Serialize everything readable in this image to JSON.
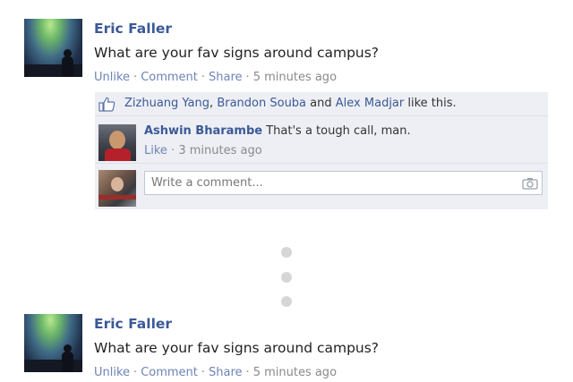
{
  "stories": [
    {
      "author": "Eric Faller",
      "message": "What are your fav signs around campus?",
      "actions": {
        "unlike": "Unlike",
        "comment": "Comment",
        "share": "Share",
        "time": "5 minutes ago",
        "separator": "·"
      }
    },
    {
      "author": "Eric Faller",
      "message": "What are your fav signs around campus?",
      "actions": {
        "unlike": "Unlike",
        "comment": "Comment",
        "share": "Share",
        "time": "5 minutes ago",
        "separator": "·"
      }
    }
  ],
  "likes": {
    "names": [
      "Zizhuang Yang",
      "Brandon Souba",
      "Alex Madjar"
    ],
    "joiner_comma": ",",
    "joiner_and": "and",
    "suffix": "like this."
  },
  "comment": {
    "author": "Ashwin Bharambe",
    "text": "That's a tough call, man.",
    "like": "Like",
    "separator": "·",
    "time": "3 minutes ago"
  },
  "composer": {
    "placeholder": "Write a comment..."
  },
  "icons": {
    "like": "thumbs-up-icon",
    "camera": "camera-icon"
  },
  "colors": {
    "link": "#3b5998",
    "action_link": "#6d84b4",
    "ufi_background": "#edeff4",
    "muted": "#8a8a8a"
  }
}
